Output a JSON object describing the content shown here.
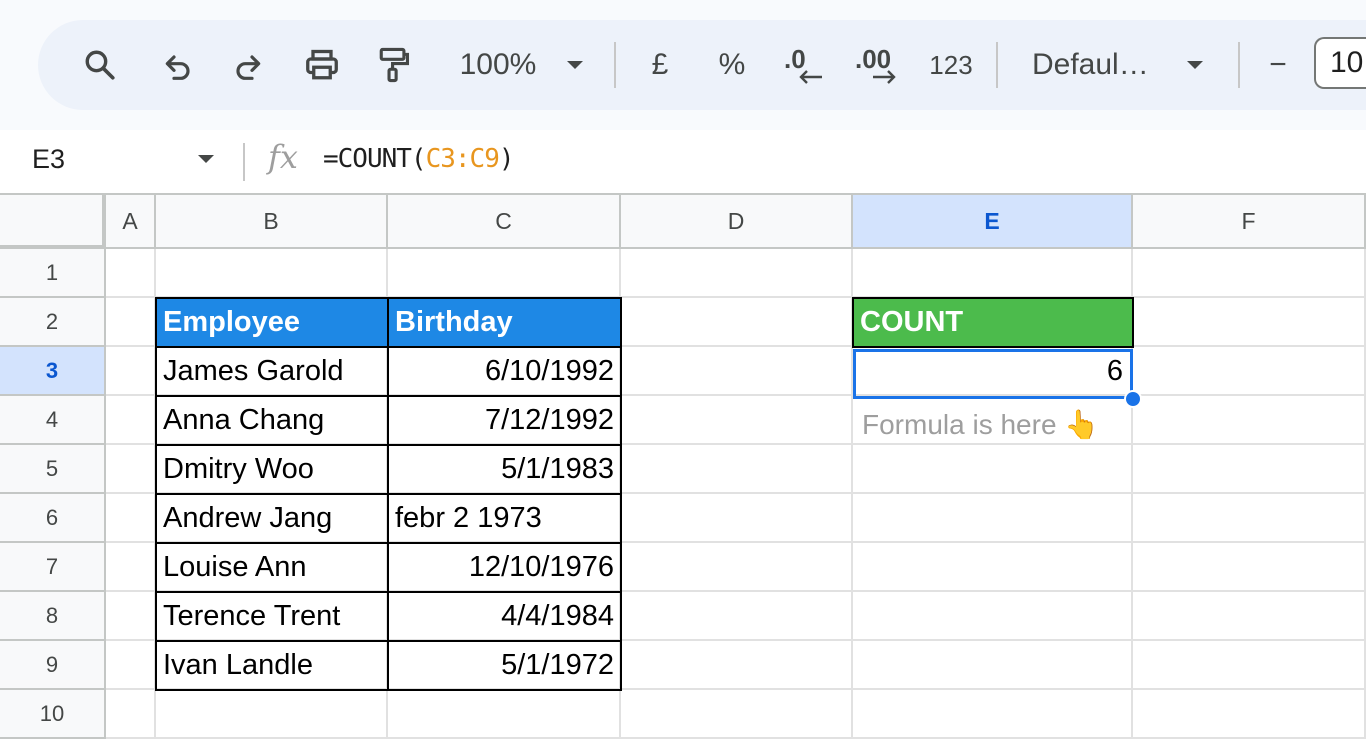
{
  "toolbar": {
    "zoom": "100%",
    "currency": "£",
    "percent": "%",
    "dec_decrease": ".0",
    "dec_increase": ".00",
    "number_format": "123",
    "font": "Defaul…",
    "minus": "−",
    "font_size": "10"
  },
  "formula_bar": {
    "name_box": "E3",
    "fx": "fx",
    "formula_prefix": "=COUNT(",
    "formula_ref": "C3:C9",
    "formula_suffix": ")"
  },
  "columns": [
    "A",
    "B",
    "C",
    "D",
    "E",
    "F"
  ],
  "selected_column": "E",
  "rows": [
    "1",
    "2",
    "3",
    "4",
    "5",
    "6",
    "7",
    "8",
    "9",
    "10"
  ],
  "selected_row": "3",
  "table": {
    "headers": [
      "Employee",
      "Birthday"
    ],
    "rows": [
      [
        "James Garold",
        "6/10/1992"
      ],
      [
        "Anna Chang",
        "7/12/1992"
      ],
      [
        "Dmitry Woo",
        "5/1/1983"
      ],
      [
        "Andrew Jang",
        "febr 2 1973"
      ],
      [
        "Louise Ann",
        "12/10/1976"
      ],
      [
        "Terence Trent",
        "4/4/1984"
      ],
      [
        "Ivan Landle",
        "5/1/1972"
      ]
    ]
  },
  "count_box": {
    "header": "COUNT",
    "value": "6",
    "note": "Formula is here 👆"
  },
  "colors": {
    "employee_header": "#1e88e5",
    "count_header": "#4cbb4c",
    "selection": "#1a73e8"
  }
}
